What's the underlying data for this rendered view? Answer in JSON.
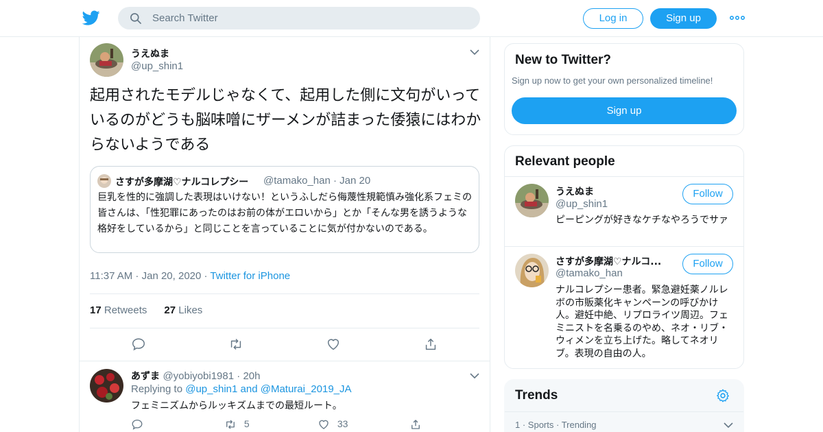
{
  "colors": {
    "accent": "#1da1f2",
    "link": "#1b95e0",
    "muted": "#657786",
    "text": "#14171a",
    "border": "#e6ecf0"
  },
  "header": {
    "logo_icon": "twitter-bird-icon",
    "search_placeholder": "Search Twitter",
    "login_label": "Log in",
    "signup_label": "Sign up",
    "more_icon": "more-dots-icon"
  },
  "tweet": {
    "author_name": "うえぬま",
    "author_handle": "@up_shin1",
    "text": "起用されたモデルじゃなくて、起用した側に文句がいっているのがどうも脳味噌にザーメンが詰まった倭猿にはわからないようである",
    "quote": {
      "name": "さすが多摩湖♡ナルコレプシー",
      "handle": "@tamako_han",
      "date": "Jan 20",
      "text": "巨乳を性的に強調した表現はいけない！というふしだら侮蔑性規範慎み強化系フェミの皆さんは、「性犯罪にあったのはお前の体がエロいから」とか「そんな男を誘うような格好をしているから」と同じことを言っていることに気が付かないのである。"
    },
    "time": "11:37 AM",
    "date": "Jan 20, 2020",
    "source": "Twitter for iPhone",
    "retweets_count": "17",
    "retweets_label": "Retweets",
    "likes_count": "27",
    "likes_label": "Likes",
    "actions": [
      "reply-icon",
      "retweet-icon",
      "like-icon",
      "share-icon"
    ]
  },
  "reply": {
    "name": "あずま",
    "handle": "@yobiyobi1981",
    "time": "20h",
    "replying_prefix": "Replying to",
    "replying_to_1": "@up_shin1",
    "replying_and": "and",
    "replying_to_2": "@Maturai_2019_JA",
    "text": "フェミニズムからルッキズムまでの最短ルート。",
    "retweets": "5",
    "likes": "33"
  },
  "sidebar": {
    "new_title": "New to Twitter?",
    "new_sub": "Sign up now to get your own personalized timeline!",
    "new_button": "Sign up",
    "relevant_title": "Relevant people",
    "people": [
      {
        "name": "うえぬま",
        "handle": "@up_shin1",
        "bio": "ピーピングが好きなケチなやろうでサァ",
        "follow": "Follow"
      },
      {
        "name": "さすが多摩湖♡ナルコ...",
        "handle": "@tamako_han",
        "bio": "ナルコレプシー患者。緊急避妊薬ノルレボの市販薬化キャンペーンの呼びかけ人。避妊中絶、リプロライツ周辺。フェミニストを名乗るのやめ、ネオ・リブ・ウィメンを立ち上げた。略してネオリブ。表現の自由の人。",
        "follow": "Follow"
      }
    ],
    "trends_title": "Trends",
    "trend_row": {
      "rank": "1",
      "category": "Sports",
      "status": "Trending"
    }
  }
}
